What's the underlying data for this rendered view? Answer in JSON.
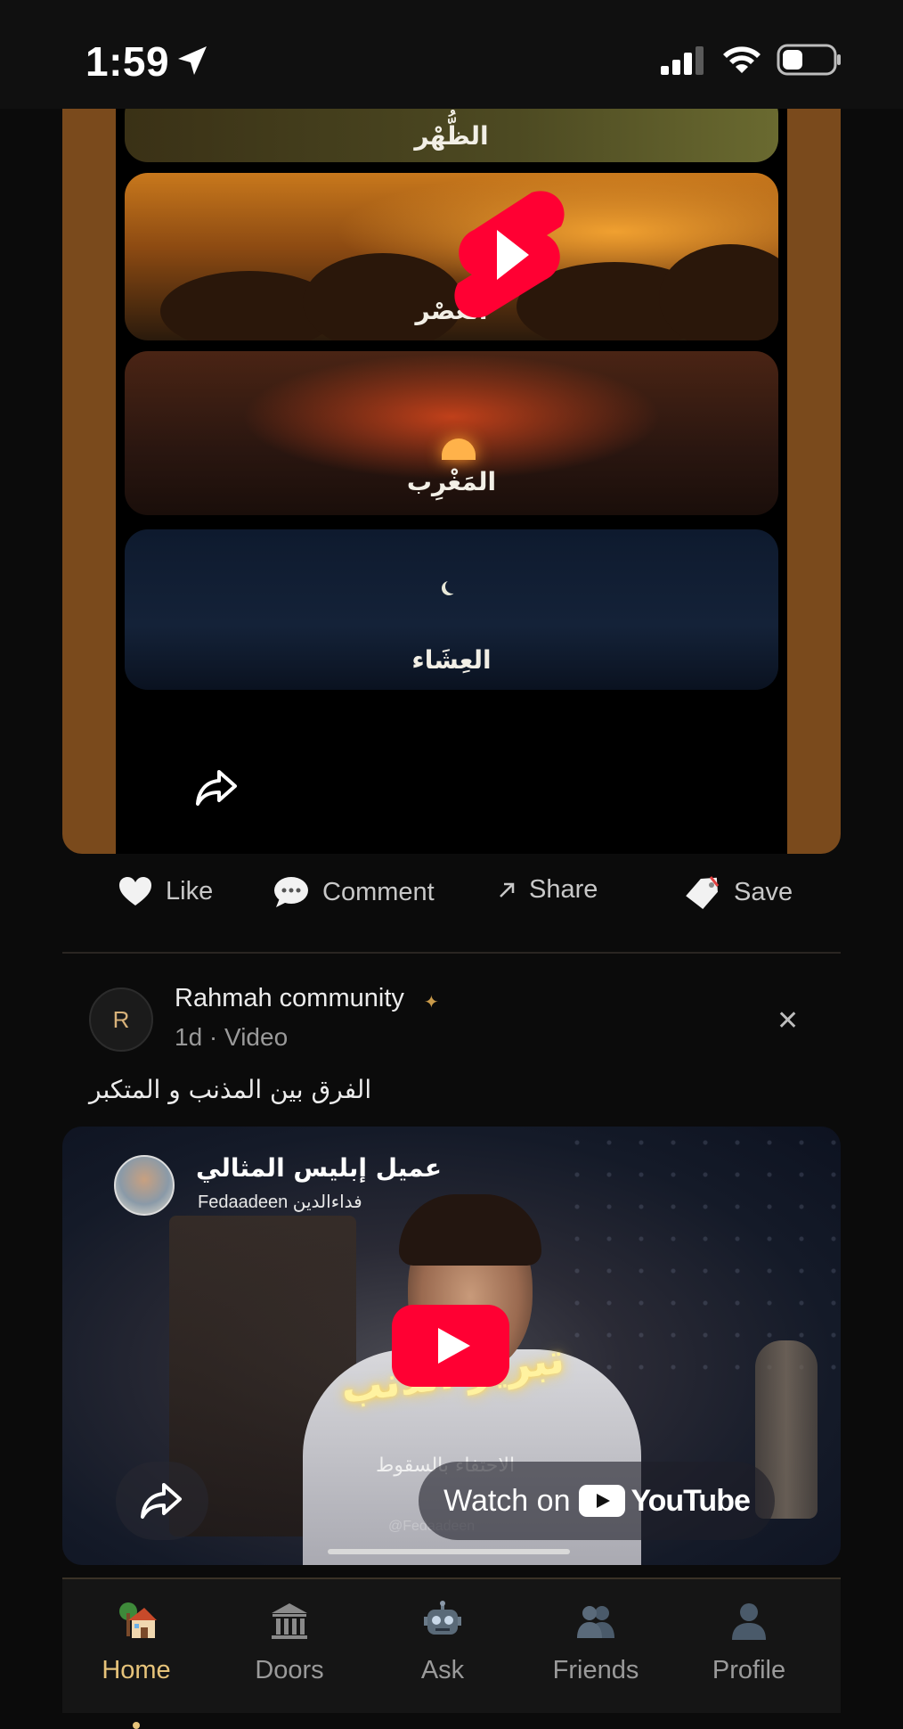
{
  "status_bar": {
    "time": "1:59"
  },
  "post1": {
    "prayer_labels": [
      "الظُّهْر",
      "العَصْر",
      "المَغْرِب",
      "العِشَاء"
    ]
  },
  "actions": {
    "like": "Like",
    "comment": "Comment",
    "share": "Share",
    "save": "Save"
  },
  "post2": {
    "avatar_letter": "R",
    "author": "Rahmah community",
    "meta": "1d · Video",
    "caption": "الفرق بين المذنب و المتكبر",
    "video": {
      "title": "عميل إبليس المثالي",
      "channel": "Fedaadeen فداءالدين",
      "overlay_text": "تبرير الذنب",
      "subtitle": "الاحتفاء بالسقوط",
      "watermark": "@Fedaadeen",
      "watch_on": "Watch on",
      "youtube": "YouTube"
    }
  },
  "nav": {
    "items": [
      {
        "label": "Home",
        "icon": "home-icon",
        "active": true
      },
      {
        "label": "Doors",
        "icon": "doors-icon",
        "active": false
      },
      {
        "label": "Ask",
        "icon": "robot-icon",
        "active": false
      },
      {
        "label": "Friends",
        "icon": "friends-icon",
        "active": false
      },
      {
        "label": "Profile",
        "icon": "profile-icon",
        "active": false
      }
    ]
  },
  "colors": {
    "accent": "#e6c37a",
    "youtube_red": "#ff0033",
    "background": "#0b0b0b"
  }
}
